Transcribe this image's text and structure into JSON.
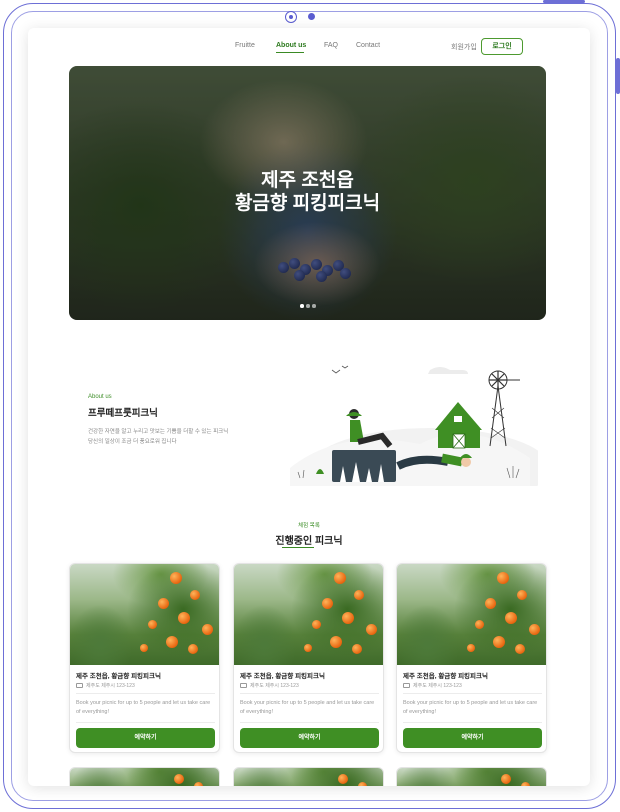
{
  "nav": {
    "links": [
      {
        "label": "Fruitte",
        "active": false
      },
      {
        "label": "About us",
        "active": true
      },
      {
        "label": "FAQ",
        "active": false
      },
      {
        "label": "Contact",
        "active": false
      }
    ],
    "signup_label": "회원가입",
    "login_label": "로그인"
  },
  "hero": {
    "title_line1": "제주 조천읍",
    "title_line2": "황금향 피킹피크닉",
    "slide_count": 3,
    "active_slide": 1
  },
  "about": {
    "kicker": "About us",
    "title": "프루떼프룻피크닉",
    "desc_line1": "건강한 자연을 알고 누리고 맛보는 기쁨을 더할 수 있는 피크닉",
    "desc_line2": "당신의 일상이 조금 더 풍요로워 집니다"
  },
  "section": {
    "kicker": "체험 목록",
    "title": "진행중인 피크닉"
  },
  "cards": [
    {
      "title": "제주 조천읍, 황금향 피킹피크닉",
      "location": "제주도 제주시 123-123",
      "desc": "Book your picnic for up to 5 people and let us take care of everything!",
      "button": "예약하기"
    },
    {
      "title": "제주 조천읍, 황금향 피킹피크닉",
      "location": "제주도 제주시 123-123",
      "desc": "Book your picnic for up to 5 people and let us take care of everything!",
      "button": "예약하기"
    },
    {
      "title": "제주 조천읍, 황금향 피킹피크닉",
      "location": "제주도 제주시 123-123",
      "desc": "Book your picnic for up to 5 people and let us take care of everything!",
      "button": "예약하기"
    }
  ],
  "colors": {
    "brand_green": "#3f8f24",
    "frame": "#6d6fd6"
  }
}
